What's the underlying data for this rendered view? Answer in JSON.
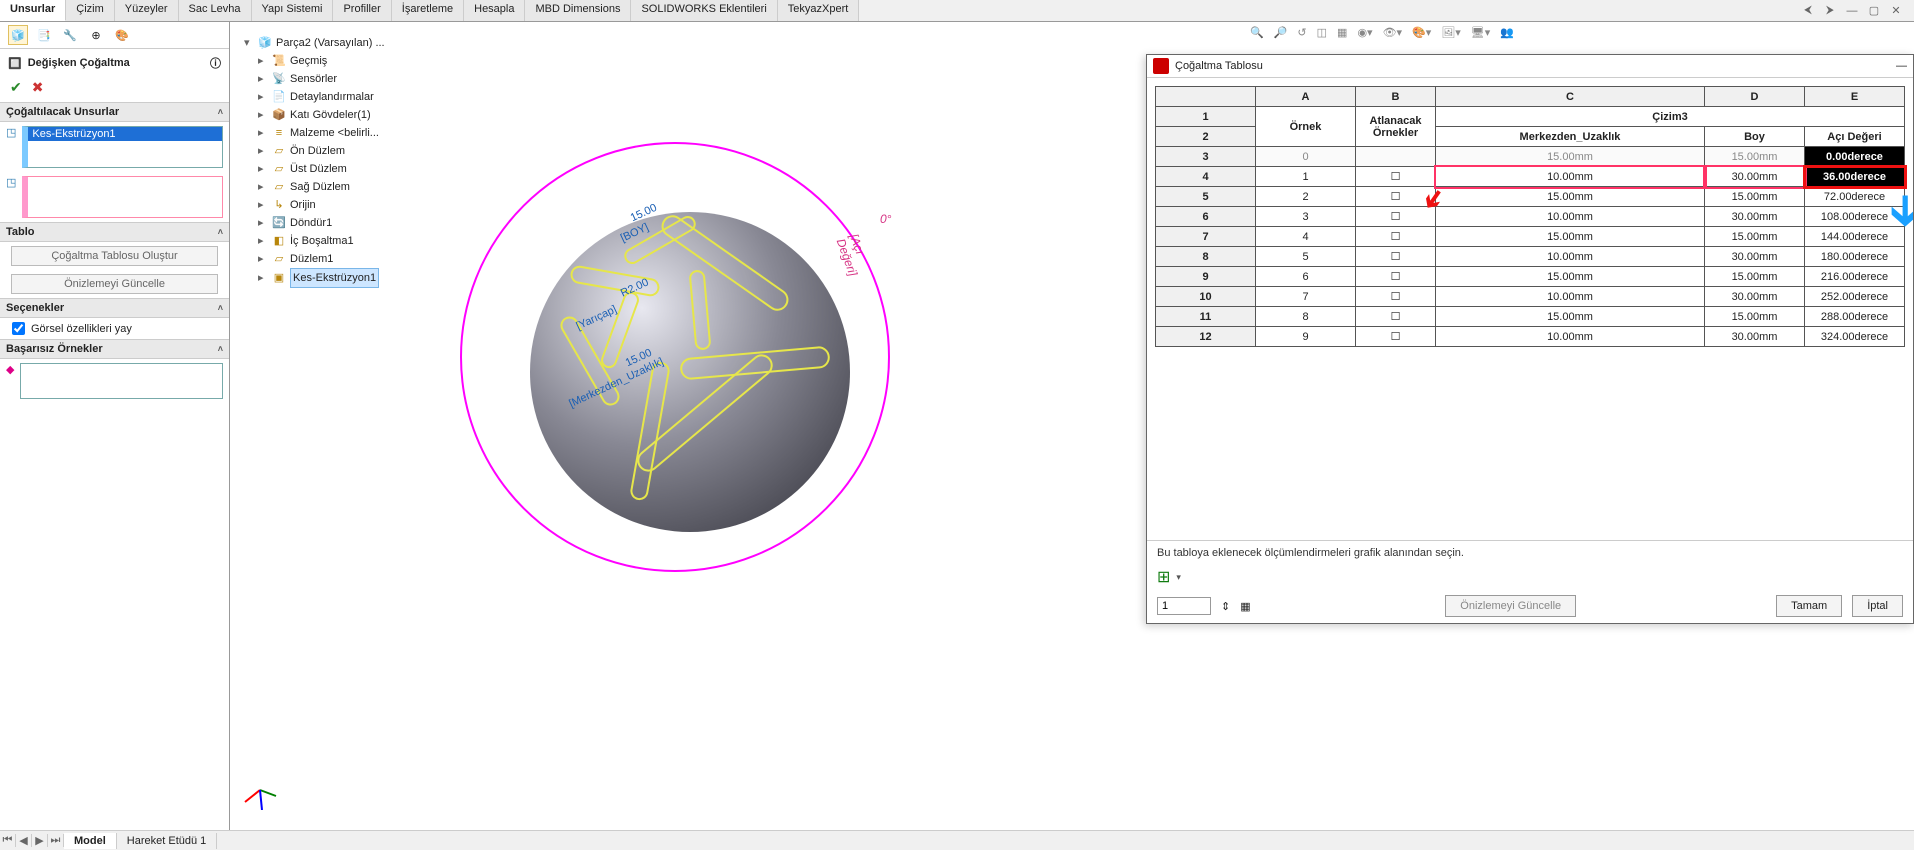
{
  "ribbon": {
    "tabs": [
      "Unsurlar",
      "Çizim",
      "Yüzeyler",
      "Sac Levha",
      "Yapı Sistemi",
      "Profiller",
      "İşaretleme",
      "Hesapla",
      "MBD Dimensions",
      "SOLIDWORKS Eklentileri",
      "TekyazXpert"
    ],
    "active": 0
  },
  "property": {
    "title": "Değişken Çoğaltma",
    "sec_features": "Çoğaltılacak Unsurlar",
    "selected_feature": "Kes-Ekstrüzyon1",
    "sec_table": "Tablo",
    "btn_create": "Çoğaltma Tablosu Oluştur",
    "btn_update": "Önizlemeyi Güncelle",
    "sec_options": "Seçenekler",
    "opt_prop": "Görsel özellikleri yay",
    "sec_failed": "Başarısız Örnekler"
  },
  "tree": {
    "root": "Parça2 (Varsayılan) ...",
    "items": [
      {
        "label": "Geçmiş",
        "ico": "📜"
      },
      {
        "label": "Sensörler",
        "ico": "📡"
      },
      {
        "label": "Detaylandırmalar",
        "ico": "📄"
      },
      {
        "label": "Katı Gövdeler(1)",
        "ico": "📦"
      },
      {
        "label": "Malzeme <belirli...",
        "ico": "≡"
      },
      {
        "label": "Ön Düzlem",
        "ico": "▱"
      },
      {
        "label": "Üst Düzlem",
        "ico": "▱"
      },
      {
        "label": "Sağ Düzlem",
        "ico": "▱"
      },
      {
        "label": "Orijin",
        "ico": "↳"
      },
      {
        "label": "Döndür1",
        "ico": "🔄"
      },
      {
        "label": "İç Boşaltma1",
        "ico": "◧"
      },
      {
        "label": "Düzlem1",
        "ico": "▱"
      },
      {
        "label": "Kes-Ekstrüzyon1",
        "ico": "▣",
        "sel": true
      }
    ]
  },
  "viewport": {
    "dims": {
      "d1": "15.00",
      "d1l": "[BOY]",
      "d2": "R2.00",
      "d2l": "[Yarıçap]",
      "d3": "15.00",
      "d3l": "[Merkezden_Uzaklık]",
      "ang": "0°",
      "angl": "[Açı Değeri]"
    }
  },
  "dialog": {
    "title": "Çoğaltma Tablosu",
    "cols": [
      "",
      "A",
      "B",
      "C",
      "D",
      "E"
    ],
    "h1": {
      "a": "Örnek",
      "b": "Atlanacak Örnekler",
      "cde": "Çizim3"
    },
    "h2": {
      "c": "Merkezden_Uzaklık",
      "d": "Boy",
      "e": "Açı Değeri"
    },
    "rows": [
      {
        "n": "3",
        "a": "0",
        "b": "",
        "c": "15.00mm",
        "d": "15.00mm",
        "e": "0.00derece",
        "dim": true
      },
      {
        "n": "4",
        "a": "1",
        "b": "☐",
        "c": "10.00mm",
        "d": "30.00mm",
        "e": "36.00derece",
        "hl": true
      },
      {
        "n": "5",
        "a": "2",
        "b": "☐",
        "c": "15.00mm",
        "d": "15.00mm",
        "e": "72.00derece"
      },
      {
        "n": "6",
        "a": "3",
        "b": "☐",
        "c": "10.00mm",
        "d": "30.00mm",
        "e": "108.00derece"
      },
      {
        "n": "7",
        "a": "4",
        "b": "☐",
        "c": "15.00mm",
        "d": "15.00mm",
        "e": "144.00derece"
      },
      {
        "n": "8",
        "a": "5",
        "b": "☐",
        "c": "10.00mm",
        "d": "30.00mm",
        "e": "180.00derece"
      },
      {
        "n": "9",
        "a": "6",
        "b": "☐",
        "c": "15.00mm",
        "d": "15.00mm",
        "e": "216.00derece"
      },
      {
        "n": "10",
        "a": "7",
        "b": "☐",
        "c": "10.00mm",
        "d": "30.00mm",
        "e": "252.00derece"
      },
      {
        "n": "11",
        "a": "8",
        "b": "☐",
        "c": "15.00mm",
        "d": "15.00mm",
        "e": "288.00derece"
      },
      {
        "n": "12",
        "a": "9",
        "b": "☐",
        "c": "10.00mm",
        "d": "30.00mm",
        "e": "324.00derece"
      }
    ],
    "note": "Bu tabloya eklenecek ölçümlendirmeleri grafik alanından seçin.",
    "num": "1",
    "btn_update": "Önizlemeyi Güncelle",
    "btn_ok": "Tamam",
    "btn_cancel": "İptal"
  },
  "bottom": {
    "tabs": [
      "Model",
      "Hareket Etüdü 1"
    ],
    "active": 0
  }
}
